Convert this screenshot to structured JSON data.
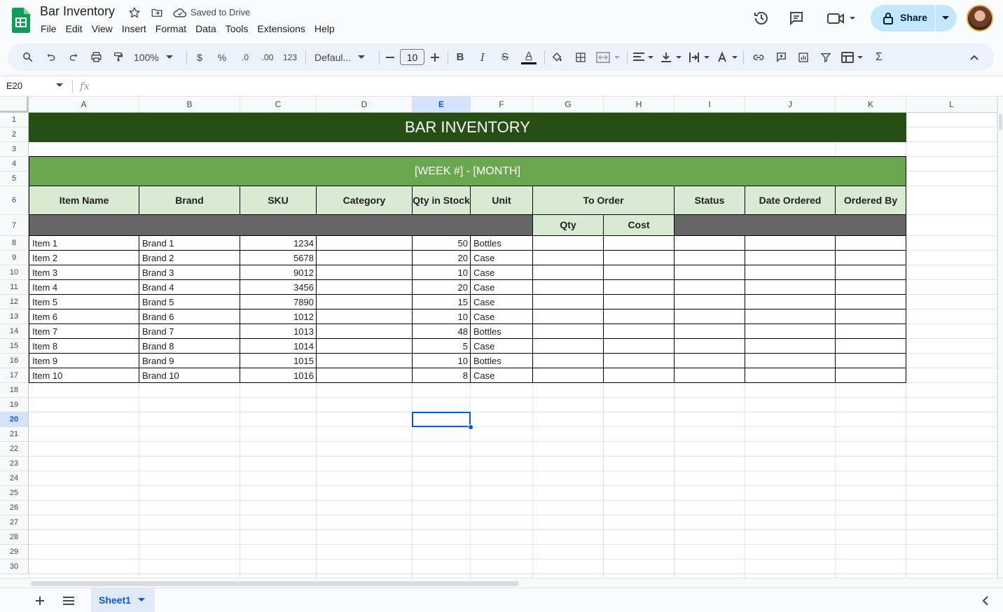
{
  "app": {
    "doc_title": "Bar Inventory",
    "saved_status": "Saved to Drive",
    "menus": [
      "File",
      "Edit",
      "View",
      "Insert",
      "Format",
      "Data",
      "Tools",
      "Extensions",
      "Help"
    ],
    "share_label": "Share",
    "accent_color": "#0b57d0",
    "icons": [
      "sheets-logo-icon",
      "star-icon",
      "move-folder-icon",
      "cloud-saved-icon",
      "history-icon",
      "comment-icon",
      "meet-icon",
      "lock-icon",
      "chevron-down-icon"
    ]
  },
  "toolbar": {
    "zoom": "100%",
    "currency": "$",
    "percent": "%",
    "dec_decrease": ".0",
    "dec_increase": ".00",
    "number_format": "123",
    "font": "Defaul...",
    "font_size": "10",
    "bold": "B",
    "italic": "I",
    "strike": "S",
    "text_color": "A",
    "sum": "Σ"
  },
  "formula_bar": {
    "cell_ref": "E20",
    "fx_label": "fx",
    "value": ""
  },
  "columns": [
    "A",
    "B",
    "C",
    "D",
    "E",
    "F",
    "G",
    "H",
    "I",
    "J",
    "K",
    "L"
  ],
  "selected_column": "E",
  "selected_row": "20",
  "rows": [
    "1",
    "2",
    "3",
    "4",
    "5",
    "6",
    "7",
    "8",
    "9",
    "10",
    "11",
    "12",
    "13",
    "14",
    "15",
    "16",
    "17",
    "18",
    "19",
    "20",
    "21",
    "22",
    "23",
    "24",
    "25",
    "26",
    "27",
    "28",
    "29",
    "30"
  ],
  "sheet": {
    "title": "BAR INVENTORY",
    "week_label": "[WEEK #] - [MONTH]",
    "headers": {
      "item_name": "Item Name",
      "brand": "Brand",
      "sku": "SKU",
      "category": "Category",
      "qty_in_stock": "Qty in Stock",
      "unit": "Unit",
      "to_order": "To Order",
      "status": "Status",
      "date_ordered": "Date Ordered",
      "ordered_by": "Ordered By",
      "qty": "Qty",
      "cost": "Cost"
    },
    "items": [
      {
        "name": "Item 1",
        "brand": "Brand 1",
        "sku": "1234",
        "qty": "50",
        "unit": "Bottles"
      },
      {
        "name": "Item 2",
        "brand": "Brand 2",
        "sku": "5678",
        "qty": "20",
        "unit": "Case"
      },
      {
        "name": "Item 3",
        "brand": "Brand 3",
        "sku": "9012",
        "qty": "10",
        "unit": "Case"
      },
      {
        "name": "Item 4",
        "brand": "Brand 4",
        "sku": "3456",
        "qty": "20",
        "unit": "Case"
      },
      {
        "name": "Item 5",
        "brand": "Brand 5",
        "sku": "7890",
        "qty": "15",
        "unit": "Case"
      },
      {
        "name": "Item 6",
        "brand": "Brand 6",
        "sku": "1012",
        "qty": "10",
        "unit": "Case"
      },
      {
        "name": "Item 7",
        "brand": "Brand 7",
        "sku": "1013",
        "qty": "48",
        "unit": "Bottles"
      },
      {
        "name": "Item 8",
        "brand": "Brand 8",
        "sku": "1014",
        "qty": "5",
        "unit": "Case"
      },
      {
        "name": "Item 9",
        "brand": "Brand 9",
        "sku": "1015",
        "qty": "10",
        "unit": "Bottles"
      },
      {
        "name": "Item 10",
        "brand": "Brand 10",
        "sku": "1016",
        "qty": "8",
        "unit": "Case"
      }
    ],
    "colors": {
      "title_band": "#274e13",
      "week_band": "#6aa84f",
      "header_fill": "#d9ead3",
      "dark_band": "#666666"
    }
  },
  "tabs": {
    "sheet_name": "Sheet1"
  }
}
